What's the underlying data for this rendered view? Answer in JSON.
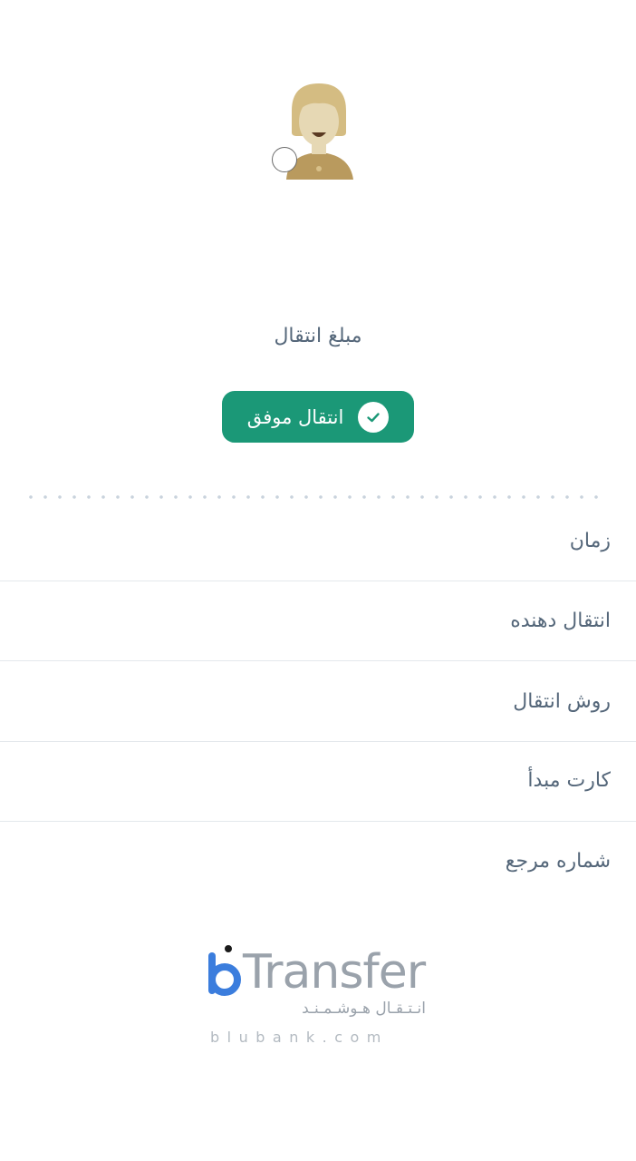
{
  "amount_label": "مبلغ انتقال",
  "status": {
    "label": "انتقال موفق",
    "color": "#1b9877",
    "icon": "check-icon"
  },
  "details": [
    {
      "label": "زمان"
    },
    {
      "label": "انتقال دهنده"
    },
    {
      "label": "روش انتقال"
    },
    {
      "label": "کارت مبدأ"
    },
    {
      "label": "شماره مرجع"
    }
  ],
  "logo": {
    "wordmark": "Transfer",
    "tagline": "انـتـقـال هـوشـمـنـد",
    "domain": "blubank.com",
    "brand_color": "#3b7ddd"
  }
}
